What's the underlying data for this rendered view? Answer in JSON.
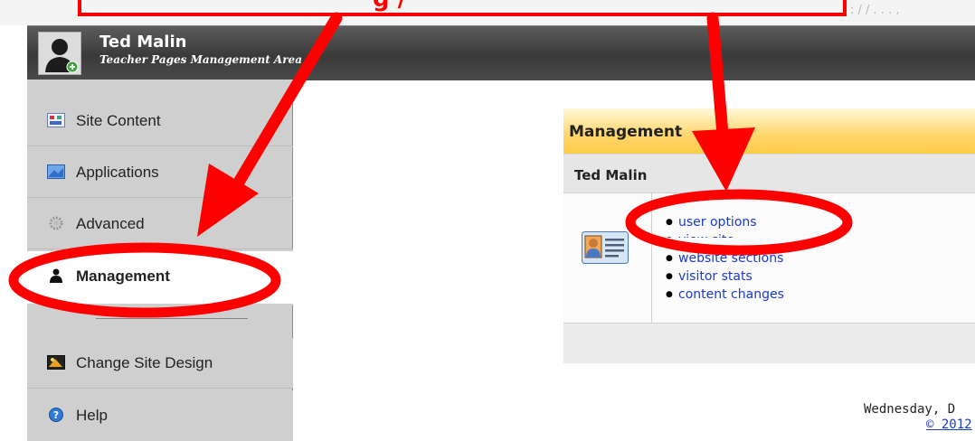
{
  "header": {
    "user_name": "Ted Malin",
    "subtitle": "Teacher Pages Management Area"
  },
  "sidebar": {
    "items": [
      {
        "label": "Site Content",
        "icon": "site-content-icon"
      },
      {
        "label": "Applications",
        "icon": "applications-icon"
      },
      {
        "label": "Advanced",
        "icon": "gear-icon"
      },
      {
        "label": "Management",
        "icon": "person-icon",
        "selected": true
      },
      {
        "label": "Change Site Design",
        "icon": "design-icon"
      },
      {
        "label": "Help",
        "icon": "help-icon"
      }
    ]
  },
  "panel": {
    "title": "Management",
    "user": "Ted Malin",
    "links": [
      "user options",
      "view site",
      "website sections",
      "visitor stats",
      "content changes"
    ]
  },
  "footer": {
    "date": "Wednesday, D",
    "copyright": "© 2012"
  },
  "annotation": {
    "callout_text": "g  /",
    "color": "#ff0000"
  },
  "colors": {
    "accent_yellow": "#ffcc4a",
    "link_blue": "#1a3ac8",
    "header_dark": "#3a3a3a"
  }
}
